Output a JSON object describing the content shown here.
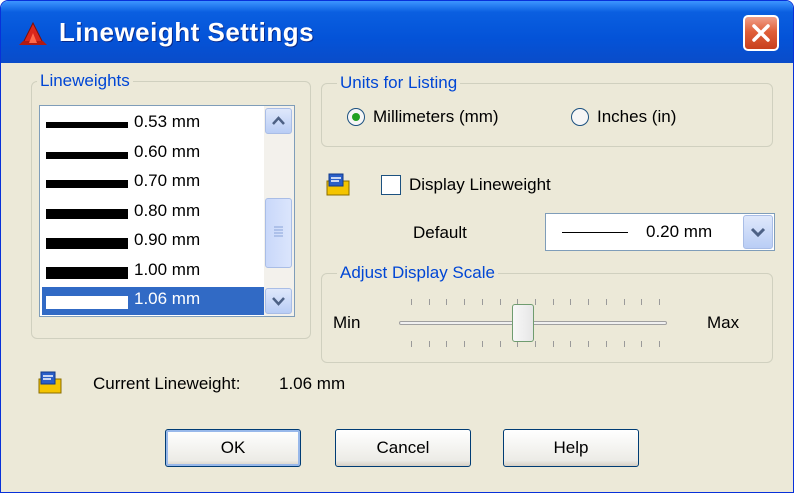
{
  "window": {
    "title": "Lineweight Settings",
    "icons": {
      "app": "autocad-icon",
      "close": "close-icon"
    }
  },
  "lineweights": {
    "group_label": "Lineweights",
    "items": [
      {
        "label": "0.53 mm",
        "thickness": 0.53
      },
      {
        "label": "0.60 mm",
        "thickness": 0.6
      },
      {
        "label": "0.70 mm",
        "thickness": 0.7
      },
      {
        "label": "0.80 mm",
        "thickness": 0.8
      },
      {
        "label": "0.90 mm",
        "thickness": 0.9
      },
      {
        "label": "1.00 mm",
        "thickness": 1.0
      },
      {
        "label": "1.06 mm",
        "thickness": 1.06,
        "selected": true
      }
    ]
  },
  "units": {
    "group_label": "Units for Listing",
    "options": [
      {
        "label": "Millimeters (mm)",
        "selected": true
      },
      {
        "label": "Inches (in)",
        "selected": false
      }
    ]
  },
  "display": {
    "checkbox_label": "Display Lineweight",
    "checked": false,
    "default_label": "Default",
    "default_value": "0.20 mm"
  },
  "scale": {
    "group_label": "Adjust Display Scale",
    "min_label": "Min",
    "max_label": "Max",
    "level_fraction": 0.45
  },
  "current": {
    "label": "Current Lineweight:",
    "value": "1.06 mm"
  },
  "buttons": {
    "ok": "OK",
    "cancel": "Cancel",
    "help": "Help"
  },
  "colors": {
    "title_bar": "#0453d8",
    "selection": "#316ac5",
    "group_label": "#0046d5",
    "radio_dot": "#21a121"
  }
}
